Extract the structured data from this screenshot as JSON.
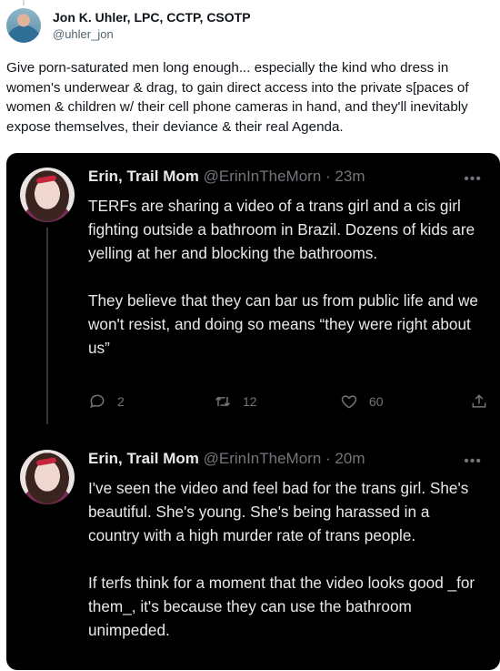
{
  "outer": {
    "author_name": "Jon K. Uhler, LPC, CCTP, CSOTP",
    "handle": "@uhler_jon",
    "text": "Give porn-saturated men long enough... especially the kind who dress in women's underwear & drag, to gain direct access into the private s[paces of women & children w/ their cell phone cameras in hand, and they'll inevitably expose themselves, their deviance & their real Agenda."
  },
  "quoted": [
    {
      "name": "Erin, Trail Mom",
      "handle": "@ErinInTheMorn",
      "time": "· 23m",
      "text": "TERFs are sharing a video of a trans girl and a cis girl fighting outside a bathroom in Brazil. Dozens of kids are yelling at her and blocking the bathrooms.\n\nThey believe that they can bar us from public life and we won't resist, and doing so means “they were right about us”",
      "replies": "2",
      "retweets": "12",
      "likes": "60"
    },
    {
      "name": "Erin, Trail Mom",
      "handle": "@ErinInTheMorn",
      "time": "· 20m",
      "text": "I've seen the video and feel bad for the trans girl. She's beautiful. She's young. She's being harassed in a country with a high murder rate of trans people.\n\nIf terfs think for a moment that the video looks good _for them_, it's because they can use the bathroom unimpeded."
    }
  ],
  "icons": [
    "more-icon",
    "reply-icon",
    "retweet-icon",
    "like-icon",
    "share-icon"
  ]
}
